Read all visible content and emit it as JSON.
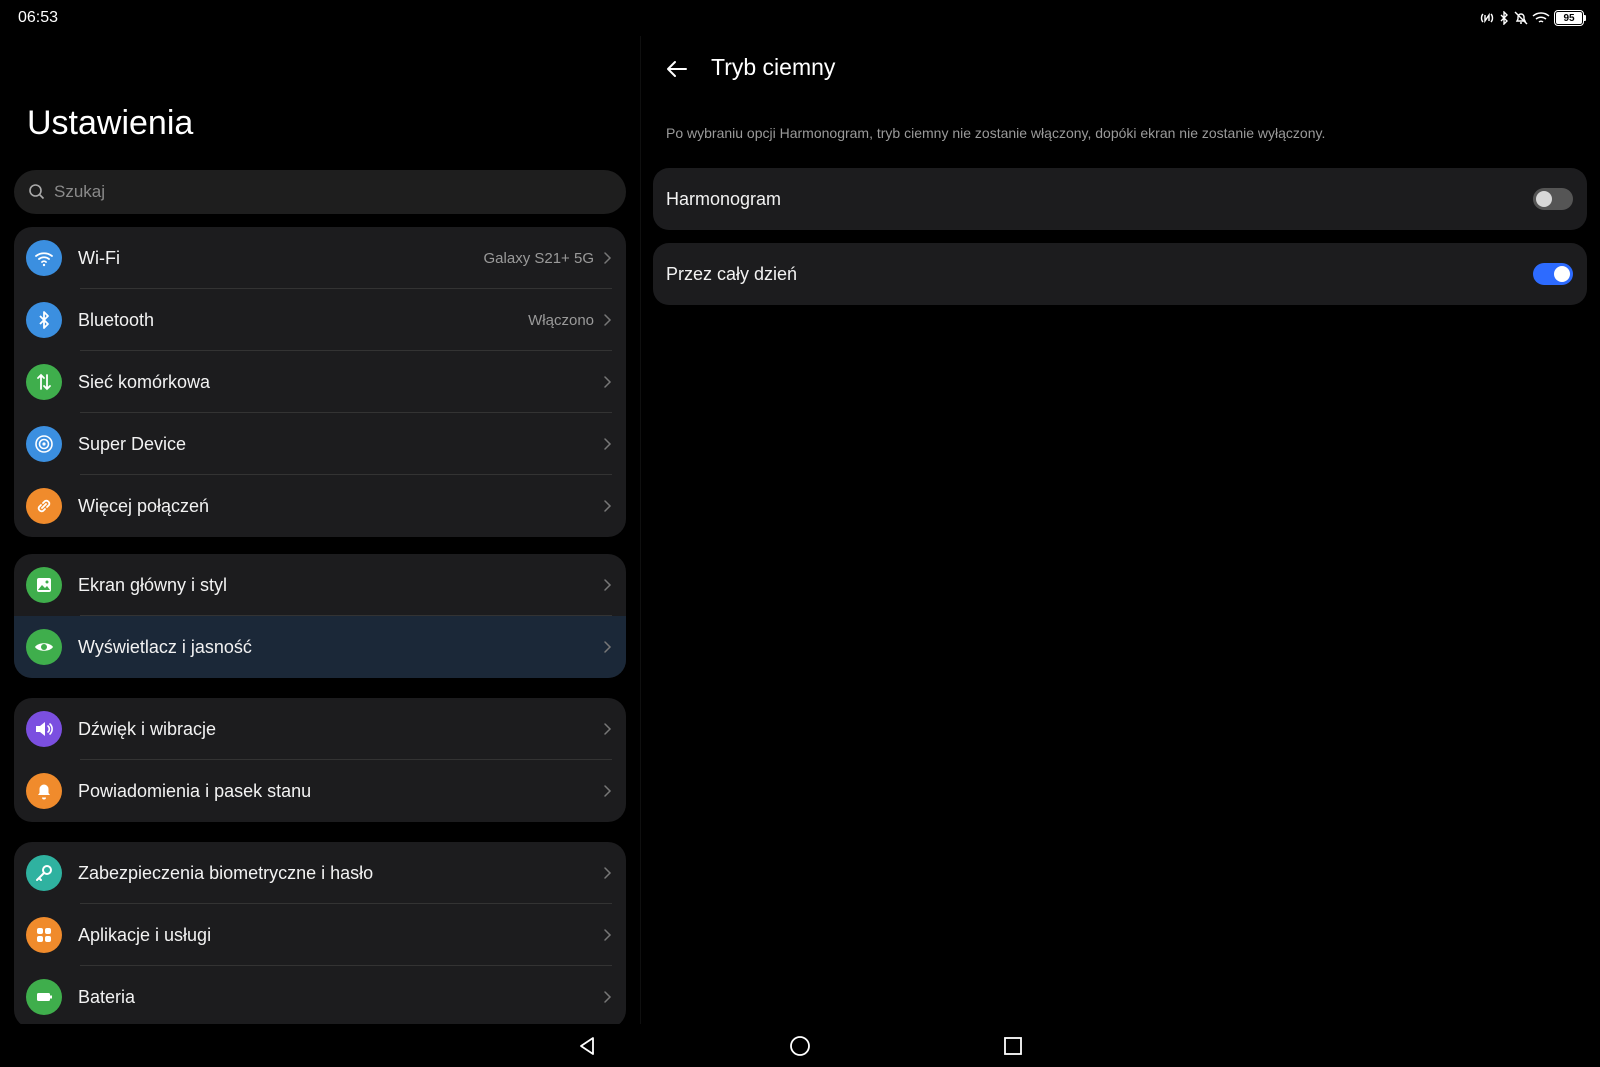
{
  "status": {
    "time": "06:53",
    "battery": "95"
  },
  "left": {
    "title": "Ustawienia",
    "search": {
      "placeholder": "Szukaj"
    },
    "groups": [
      {
        "items": [
          {
            "label": "Wi-Fi",
            "value": "Galaxy S21+ 5G",
            "icon": "wifi-icon",
            "color": "#3b8fe0"
          },
          {
            "label": "Bluetooth",
            "value": "Włączono",
            "icon": "bluetooth-icon",
            "color": "#3b8fe0"
          },
          {
            "label": "Sieć komórkowa",
            "value": "",
            "icon": "mobile-data-icon",
            "color": "#3fae4c"
          },
          {
            "label": "Super Device",
            "value": "",
            "icon": "super-device-icon",
            "color": "#3b8fe0"
          },
          {
            "label": "Więcej połączeń",
            "value": "",
            "icon": "link-icon",
            "color": "#f08b2c"
          }
        ]
      },
      {
        "items": [
          {
            "label": "Ekran główny i styl",
            "value": "",
            "icon": "image-icon",
            "color": "#3fae4c"
          },
          {
            "label": "Wyświetlacz i jasność",
            "value": "",
            "icon": "eye-icon",
            "color": "#3fae4c",
            "active": true
          }
        ]
      },
      {
        "items": [
          {
            "label": "Dźwięk i wibracje",
            "value": "",
            "icon": "speaker-icon",
            "color": "#7b4fe0"
          },
          {
            "label": "Powiadomienia i pasek stanu",
            "value": "",
            "icon": "bell-icon",
            "color": "#f08b2c"
          }
        ]
      },
      {
        "items": [
          {
            "label": "Zabezpieczenia biometryczne i hasło",
            "value": "",
            "icon": "key-icon",
            "color": "#2fb2a0"
          },
          {
            "label": "Aplikacje i usługi",
            "value": "",
            "icon": "apps-icon",
            "color": "#f08b2c"
          },
          {
            "label": "Bateria",
            "value": "",
            "icon": "battery-icon",
            "color": "#3fae4c"
          }
        ]
      }
    ]
  },
  "right": {
    "title": "Tryb ciemny",
    "description": "Po wybraniu opcji Harmonogram, tryb ciemny nie zostanie włączony, dopóki ekran nie zostanie wyłączony.",
    "options": [
      {
        "label": "Harmonogram",
        "enabled": false
      },
      {
        "label": "Przez cały dzień",
        "enabled": true
      }
    ]
  },
  "colors": {
    "accent": "#2d6bff",
    "card": "#1c1c1e",
    "active_row": "#1b2838"
  }
}
